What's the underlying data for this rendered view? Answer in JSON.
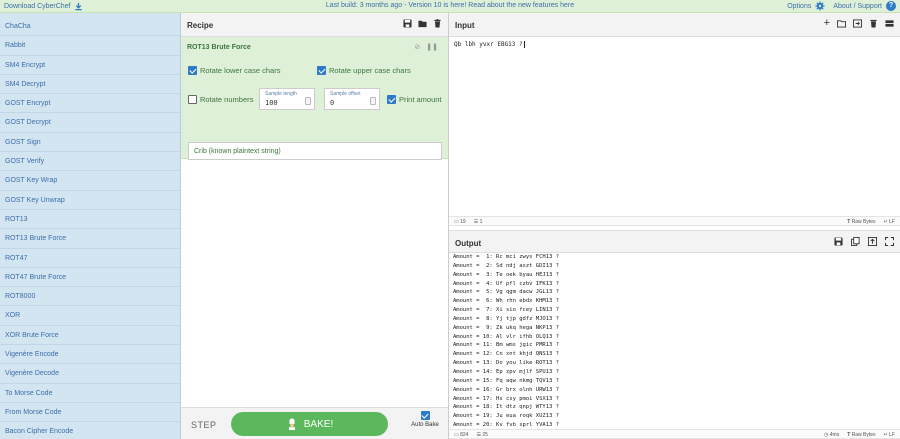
{
  "banner": {
    "download_label": "Download CyberChef",
    "notice_prefix": "Last build: 3 months ago - Version 10 is here! Read about the new features here",
    "options_label": "Options",
    "about_label": "About / Support"
  },
  "operations": [
    "ChaCha",
    "Rabbit",
    "SM4 Encrypt",
    "SM4 Decrypt",
    "GOST Encrypt",
    "GOST Decrypt",
    "GOST Sign",
    "GOST Verify",
    "GOST Key Wrap",
    "GOST Key Unwrap",
    "ROT13",
    "ROT13 Brute Force",
    "ROT47",
    "ROT47 Brute Force",
    "ROT8000",
    "XOR",
    "XOR Brute Force",
    "Vigenère Encode",
    "Vigenère Decode",
    "To Morse Code",
    "From Morse Code",
    "Bacon Cipher Encode"
  ],
  "recipe": {
    "title": "Recipe",
    "operation": {
      "title": "ROT13 Brute Force",
      "rotate_lower": "Rotate lower case chars",
      "rotate_upper": "Rotate upper case chars",
      "rotate_numbers": "Rotate numbers",
      "sample_length_label": "Sample length",
      "sample_length_value": "100",
      "sample_offset_label": "Sample offset",
      "sample_offset_value": "0",
      "print_amount": "Print amount",
      "crib_placeholder": "Crib (known plaintext string)"
    },
    "step_label": "STEP",
    "bake_label": "BAKE!",
    "autobake_label": "Auto Bake"
  },
  "input": {
    "title": "Input",
    "text": "Qb lbh yvxr EBG13 ?",
    "status": {
      "length": "19",
      "lines": "1",
      "raw_bytes": "Raw Bytes",
      "eol": "LF"
    }
  },
  "output": {
    "title": "Output",
    "lines": [
      "Amount =  1: Rc mci zwys FCH13 ?",
      "Amount =  2: Sd ndj axzt GDI13 ?",
      "Amount =  3: Te oek byau HEJ13 ?",
      "Amount =  4: Uf pfl czbv IFK13 ?",
      "Amount =  5: Vg qgm dacw JGL13 ?",
      "Amount =  6: Wh rhn ebdx KHM13 ?",
      "Amount =  7: Xi sio fcey LIN13 ?",
      "Amount =  8: Yj tjp gdfz MJO13 ?",
      "Amount =  9: Zk ukq hega NKP13 ?",
      "Amount = 10: Al vlr ifhb OLQ13 ?",
      "Amount = 11: Bm wms jgic PMR13 ?",
      "Amount = 12: Cn xnt khjd QNS13 ?",
      "Amount = 13: Do you like ROT13 ?",
      "Amount = 14: Ep zpv mjlf SPU13 ?",
      "Amount = 15: Fq aqw nkmg TQV13 ?",
      "Amount = 16: Gr brx olnh URW13 ?",
      "Amount = 17: Hs csy pmoi VSX13 ?",
      "Amount = 18: It dtz qnpj WTY13 ?",
      "Amount = 19: Ju eua roqk XUZ13 ?",
      "Amount = 20: Kv fvb sprl YVA13 ?"
    ],
    "status": {
      "length": "824",
      "lines": "25",
      "time": "4ms",
      "raw_bytes": "Raw Bytes",
      "eol": "LF"
    }
  },
  "colors": {
    "banner_bg": "#dff0d8",
    "sidebar_bg": "#d4e5f2",
    "op_block_bg": "#dff0d8",
    "bake_green": "#5cb85c",
    "accent": "#2e7bc9"
  }
}
